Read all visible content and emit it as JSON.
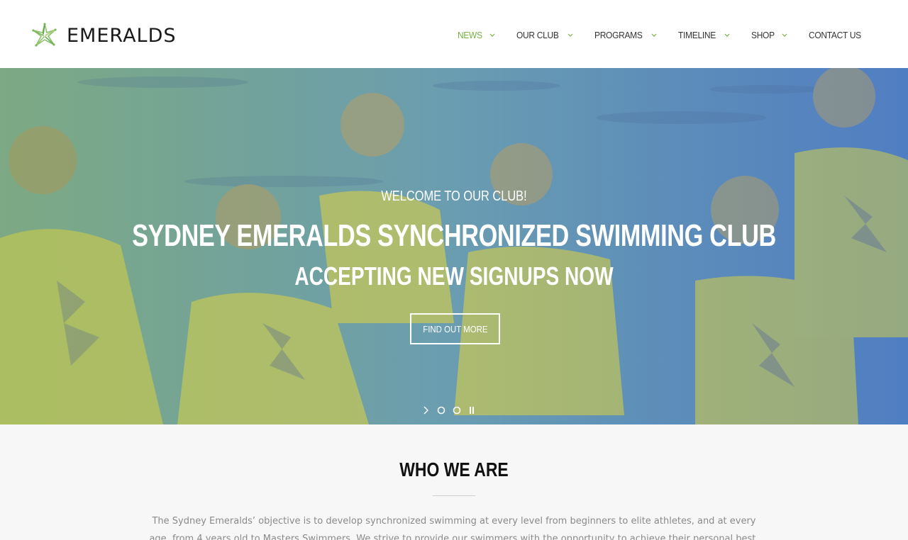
{
  "header": {
    "brand": "EMERALDS",
    "nav": [
      {
        "label": "NEWS",
        "active": true,
        "has_dropdown": true
      },
      {
        "label": "OUR CLUB",
        "active": false,
        "has_dropdown": true
      },
      {
        "label": "PROGRAMS",
        "active": false,
        "has_dropdown": true
      },
      {
        "label": "TIMELINE",
        "active": false,
        "has_dropdown": true
      },
      {
        "label": "SHOP",
        "active": false,
        "has_dropdown": true
      },
      {
        "label": "CONTACT US",
        "active": false,
        "has_dropdown": false
      }
    ]
  },
  "hero": {
    "welcome": "WELCOME TO OUR CLUB!",
    "title": "SYDNEY EMERALDS SYNCHRONIZED SWIMMING CLUB",
    "subtitle": "ACCEPTING NEW SIGNUPS NOW",
    "cta_label": "FIND OUT MORE"
  },
  "about": {
    "title": "WHO WE ARE",
    "text": "The Sydney Emeralds’ objective is to develop synchronized swimming at every level from beginners to elite athletes, and at every age, from 4 years old to Masters Swimmers. We strive to provide our swimmers with the opportunity to achieve their personal best."
  },
  "colors": {
    "accent": "#78b043",
    "nav_text": "#333333",
    "hero_text": "#ffffff"
  },
  "icons": {
    "logo": "star-burst-logo-icon",
    "dropdown": "chevron-down-icon",
    "slider_next": "chevron-right-icon",
    "slider_dot": "circle-icon",
    "slider_pause": "pause-icon"
  }
}
